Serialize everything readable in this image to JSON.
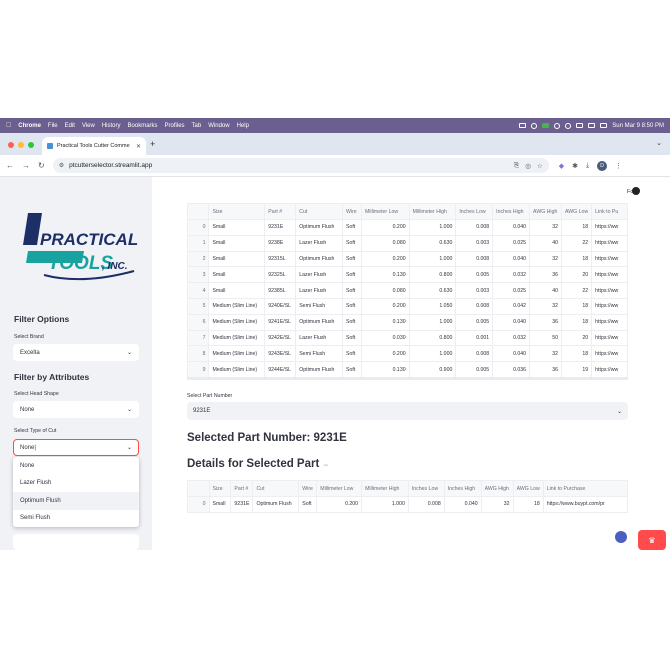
{
  "menubar": {
    "app": "Chrome",
    "items": [
      "File",
      "Edit",
      "View",
      "History",
      "Bookmarks",
      "Profiles",
      "Tab",
      "Window",
      "Help"
    ],
    "clock": "Sun Mar 9  8:50 PM"
  },
  "browser": {
    "tab_title": "Practical Tools Cutter Comme",
    "url": "ptcutterselector.streamlit.app",
    "profile_initial": "D"
  },
  "sidebar": {
    "logo_line1": "PRACTICAL",
    "logo_line2": "TOOLS",
    "logo_suffix": ", INC.",
    "filter_options_heading": "Filter Options",
    "brand_label": "Select Brand",
    "brand_value": "Excelta",
    "filter_attributes_heading": "Filter by Attributes",
    "head_shape_label": "Select Head Shape",
    "head_shape_value": "None",
    "type_of_cut_label": "Select Type of Cut",
    "type_of_cut_value": "None",
    "type_of_cut_options": [
      "None",
      "Lazer Flush",
      "Optimum Flush",
      "Semi Flush"
    ]
  },
  "header": {
    "fork_label": "Fork"
  },
  "main_table": {
    "columns": [
      "",
      "Size",
      "Part #",
      "Cut",
      "Wire",
      "Millimeter Low",
      "Millimeter High",
      "Inches Low",
      "Inches High",
      "AWG High",
      "AWG Low",
      "Link to Pu"
    ],
    "rows": [
      [
        "0",
        "Small",
        "9231E",
        "Optimum Flush",
        "Soft",
        "0.200",
        "1.000",
        "0.008",
        "0.040",
        "32",
        "18",
        "https://ww"
      ],
      [
        "1",
        "Small",
        "9238E",
        "Lazer Flush",
        "Soft",
        "0.080",
        "0.630",
        "0.003",
        "0.025",
        "40",
        "22",
        "https://ww"
      ],
      [
        "2",
        "Small",
        "92315L",
        "Optimum Flush",
        "Soft",
        "0.200",
        "1.000",
        "0.008",
        "0.040",
        "32",
        "18",
        "https://ww"
      ],
      [
        "3",
        "Small",
        "92325L",
        "Lazer Flush",
        "Soft",
        "0.130",
        "0.800",
        "0.005",
        "0.032",
        "36",
        "20",
        "https://ww"
      ],
      [
        "4",
        "Small",
        "92385L",
        "Lazer Flush",
        "Soft",
        "0.080",
        "0.630",
        "0.003",
        "0.025",
        "40",
        "22",
        "https://ww"
      ],
      [
        "5",
        "Medium (Slim Line)",
        "9240E/SL",
        "Semi Flush",
        "Soft",
        "0.200",
        "1.050",
        "0.008",
        "0.042",
        "32",
        "18",
        "https://ww"
      ],
      [
        "6",
        "Medium (Slim Line)",
        "9241E/SL",
        "Optimum Flush",
        "Soft",
        "0.130",
        "1.000",
        "0.005",
        "0.040",
        "36",
        "18",
        "https://ww"
      ],
      [
        "7",
        "Medium (Slim Line)",
        "9242E/SL",
        "Lazer Flush",
        "Soft",
        "0.030",
        "0.800",
        "0.001",
        "0.032",
        "50",
        "20",
        "https://ww"
      ],
      [
        "8",
        "Medium (Slim Line)",
        "9243E/SL",
        "Semi Flush",
        "Soft",
        "0.200",
        "1.000",
        "0.008",
        "0.040",
        "32",
        "18",
        "https://ww"
      ],
      [
        "9",
        "Medium (Slim Line)",
        "9244E/SL",
        "Optimum Flush",
        "Soft",
        "0.130",
        "0.900",
        "0.005",
        "0.036",
        "36",
        "19",
        "https://ww"
      ]
    ]
  },
  "part_select": {
    "label": "Select Part Number",
    "value": "9231E"
  },
  "selected_heading": "Selected Part Number: 9231E",
  "details_heading": "Details for Selected Part",
  "details_table": {
    "columns": [
      "",
      "Size",
      "Part #",
      "Cut",
      "Wire",
      "Millimeter Low",
      "Millimeter High",
      "Inches Low",
      "Inches High",
      "AWG High",
      "AWG Low",
      "Link to Purchase"
    ],
    "rows": [
      [
        "0",
        "Small",
        "9231E",
        "Optimum Flush",
        "Soft",
        "0.200",
        "1.000",
        "0.008",
        "0.040",
        "32",
        "18",
        "https://www.buypt.com/pr"
      ]
    ]
  },
  "colors": {
    "menubar": "#6a5f8e",
    "sidebar_bg": "#f0f2f6",
    "accent_red": "#ff4b4b",
    "logo_navy": "#1e2e66",
    "logo_teal": "#18a3a0"
  }
}
